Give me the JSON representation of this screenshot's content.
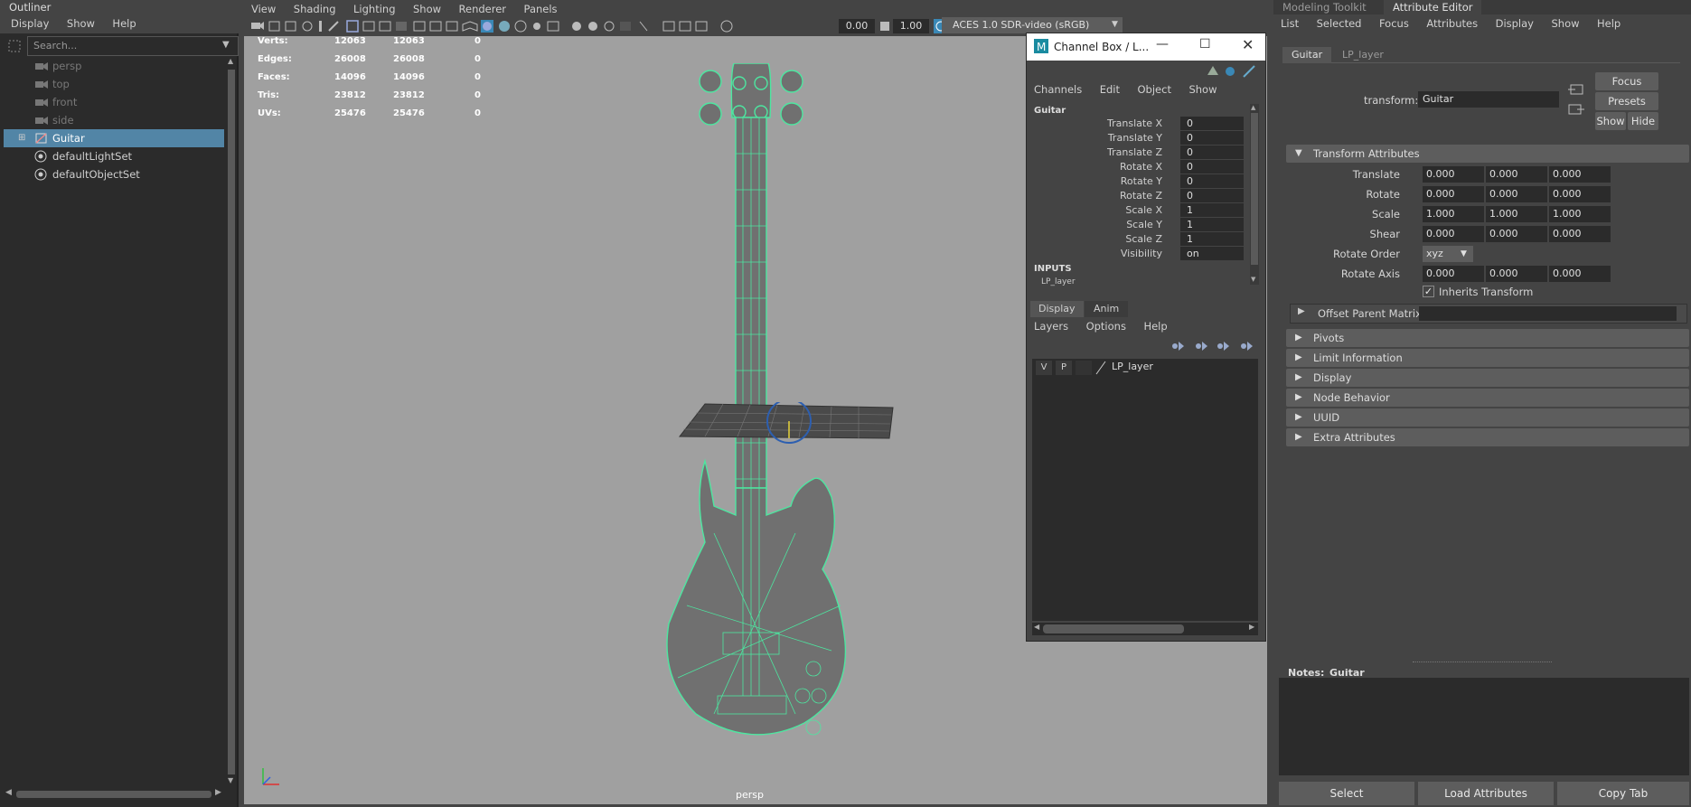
{
  "outliner": {
    "title": "Outliner",
    "menu": [
      "Display",
      "Show",
      "Help"
    ],
    "search_placeholder": "Search...",
    "items": [
      {
        "label": "persp",
        "icon": "camera-icon"
      },
      {
        "label": "top",
        "icon": "camera-icon"
      },
      {
        "label": "front",
        "icon": "camera-icon"
      },
      {
        "label": "side",
        "icon": "camera-icon"
      },
      {
        "label": "Guitar",
        "icon": "transform-icon"
      },
      {
        "label": "defaultLightSet",
        "icon": "set-icon"
      },
      {
        "label": "defaultObjectSet",
        "icon": "set-icon"
      }
    ]
  },
  "viewport": {
    "menu": [
      "View",
      "Shading",
      "Lighting",
      "Show",
      "Renderer",
      "Panels"
    ],
    "toolbar": {
      "exposure": "0.00",
      "gamma": "1.00",
      "color_space": "ACES 1.0 SDR-video (sRGB)"
    },
    "hud": [
      {
        "label": "Verts:",
        "a": "12063",
        "b": "12063",
        "c": "0"
      },
      {
        "label": "Edges:",
        "a": "26008",
        "b": "26008",
        "c": "0"
      },
      {
        "label": "Faces:",
        "a": "14096",
        "b": "14096",
        "c": "0"
      },
      {
        "label": "Tris:",
        "a": "23812",
        "b": "23812",
        "c": "0"
      },
      {
        "label": "UVs:",
        "a": "25476",
        "b": "25476",
        "c": "0"
      }
    ],
    "camera": "persp",
    "wire_color": "#4de6a0"
  },
  "channel_box": {
    "title": "Channel Box / L...",
    "menu": [
      "Channels",
      "Edit",
      "Object",
      "Show"
    ],
    "object": "Guitar",
    "channels": [
      {
        "label": "Translate X",
        "value": "0"
      },
      {
        "label": "Translate Y",
        "value": "0"
      },
      {
        "label": "Translate Z",
        "value": "0"
      },
      {
        "label": "Rotate X",
        "value": "0"
      },
      {
        "label": "Rotate Y",
        "value": "0"
      },
      {
        "label": "Rotate Z",
        "value": "0"
      },
      {
        "label": "Scale X",
        "value": "1"
      },
      {
        "label": "Scale Y",
        "value": "1"
      },
      {
        "label": "Scale Z",
        "value": "1"
      },
      {
        "label": "Visibility",
        "value": "on"
      }
    ],
    "inputs_label": "INPUTS",
    "inputs_item": "LP_layer",
    "tabs": [
      "Display",
      "Anim"
    ],
    "layer_menu": [
      "Layers",
      "Options",
      "Help"
    ],
    "layer": {
      "v": "V",
      "p": "P",
      "name": "LP_layer"
    }
  },
  "attribute_editor": {
    "top_tabs": [
      "Modeling Toolkit",
      "Attribute Editor"
    ],
    "menu": [
      "List",
      "Selected",
      "Focus",
      "Attributes",
      "Display",
      "Show",
      "Help"
    ],
    "node_tabs": [
      "Guitar",
      "LP_layer"
    ],
    "transform_label": "transform:",
    "transform_value": "Guitar",
    "buttons": {
      "focus": "Focus",
      "presets": "Presets",
      "show": "Show",
      "hide": "Hide"
    },
    "section_title": "Transform Attributes",
    "rows": [
      {
        "label": "Translate",
        "values": [
          "0.000",
          "0.000",
          "0.000"
        ]
      },
      {
        "label": "Rotate",
        "values": [
          "0.000",
          "0.000",
          "0.000"
        ]
      },
      {
        "label": "Scale",
        "values": [
          "1.000",
          "1.000",
          "1.000"
        ]
      },
      {
        "label": "Shear",
        "values": [
          "0.000",
          "0.000",
          "0.000"
        ]
      }
    ],
    "rotate_order_label": "Rotate Order",
    "rotate_order_value": "xyz",
    "rotate_axis_label": "Rotate Axis",
    "rotate_axis_values": [
      "0.000",
      "0.000",
      "0.000"
    ],
    "inherits_label": "Inherits Transform",
    "offset_label": "Offset Parent Matrix",
    "collapsed_sections": [
      "Pivots",
      "Limit Information",
      "Display",
      "Node Behavior",
      "UUID",
      "Extra Attributes"
    ],
    "notes_label": "Notes:",
    "notes_value": "Guitar",
    "bottom_buttons": [
      "Select",
      "Load Attributes",
      "Copy Tab"
    ]
  }
}
